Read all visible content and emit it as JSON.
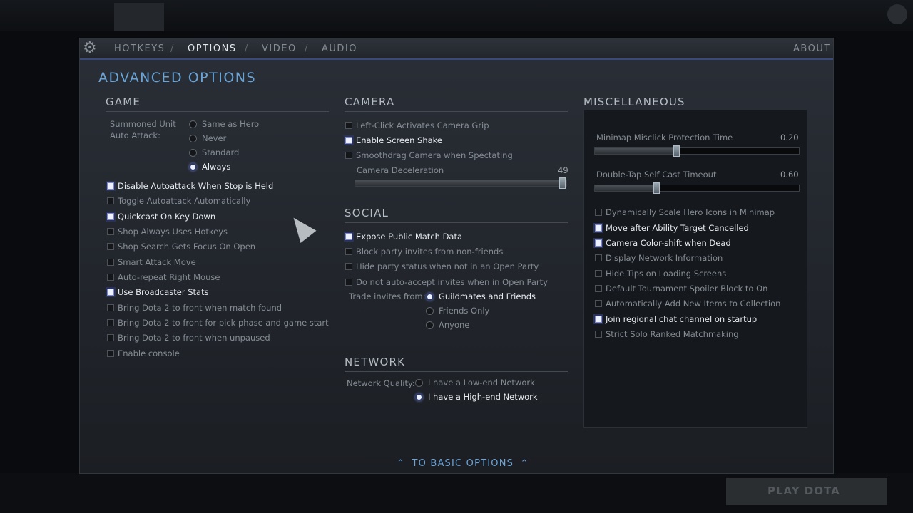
{
  "tabs": {
    "hotkeys": "HOTKEYS",
    "options": "OPTIONS",
    "video": "VIDEO",
    "audio": "AUDIO",
    "about": "ABOUT",
    "sep": "/"
  },
  "page_title": "ADVANCED OPTIONS",
  "icons": {
    "gear": "gear-icon",
    "cursor": "mouse-cursor-icon",
    "chevron": "chevron-up-icon"
  },
  "game": {
    "title": "GAME",
    "summoned_label_1": "Summoned Unit",
    "summoned_label_2": "Auto Attack:",
    "summoned_options": [
      "Same as Hero",
      "Never",
      "Standard",
      "Always"
    ],
    "summoned_selected": "Always",
    "checks": [
      {
        "label": "Disable Autoattack When Stop is Held",
        "checked": true
      },
      {
        "label": "Toggle Autoattack Automatically",
        "checked": false
      },
      {
        "label": "Quickcast On Key Down",
        "checked": true
      },
      {
        "label": "Shop Always Uses Hotkeys",
        "checked": false
      },
      {
        "label": "Shop Search Gets Focus On Open",
        "checked": false
      },
      {
        "label": "Smart Attack Move",
        "checked": false
      },
      {
        "label": "Auto-repeat Right Mouse",
        "checked": false
      },
      {
        "label": "Use Broadcaster Stats",
        "checked": true
      },
      {
        "label": "Bring Dota 2 to front when match found",
        "checked": false
      },
      {
        "label": "Bring Dota 2 to front for pick phase and game start",
        "checked": false
      },
      {
        "label": "Bring Dota 2 to front when unpaused",
        "checked": false
      },
      {
        "label": "Enable console",
        "checked": false
      }
    ]
  },
  "camera": {
    "title": "CAMERA",
    "checks": [
      {
        "label": "Left-Click Activates Camera Grip",
        "checked": false
      },
      {
        "label": "Enable Screen Shake",
        "checked": true
      },
      {
        "label": "Smoothdrag Camera when Spectating",
        "checked": false
      }
    ],
    "deceleration_label": "Camera Deceleration",
    "deceleration_value": "49",
    "deceleration_fraction": 0.98
  },
  "social": {
    "title": "SOCIAL",
    "checks": [
      {
        "label": "Expose Public Match Data",
        "checked": true
      },
      {
        "label": "Block party invites from non-friends",
        "checked": false
      },
      {
        "label": "Hide party status when not in an Open Party",
        "checked": false
      },
      {
        "label": "Do not auto-accept invites when in Open Party",
        "checked": false
      }
    ],
    "trade_label": "Trade invites from:",
    "trade_options": [
      "Guildmates and Friends",
      "Friends Only",
      "Anyone"
    ],
    "trade_selected": "Guildmates and Friends"
  },
  "network": {
    "title": "NETWORK",
    "label": "Network Quality:",
    "options": [
      "I have a Low-end Network",
      "I have a High-end Network"
    ],
    "selected": "I have a High-end Network"
  },
  "misc": {
    "title": "MISCELLANEOUS",
    "minimap_label": "Minimap Misclick Protection Time",
    "minimap_value": "0.20",
    "minimap_fraction": 0.4,
    "doubletap_label": "Double-Tap Self Cast Timeout",
    "doubletap_value": "0.60",
    "doubletap_fraction": 0.3,
    "checks": [
      {
        "label": "Dynamically Scale Hero Icons in Minimap",
        "checked": false
      },
      {
        "label": "Move after Ability Target Cancelled",
        "checked": true
      },
      {
        "label": "Camera Color-shift when Dead",
        "checked": true
      },
      {
        "label": "Display Network Information",
        "checked": false
      },
      {
        "label": "Hide Tips on Loading Screens",
        "checked": false
      },
      {
        "label": "Default Tournament Spoiler Block to On",
        "checked": false
      },
      {
        "label": "Automatically Add New Items to Collection",
        "checked": false
      },
      {
        "label": "Join regional chat channel on startup",
        "checked": true
      },
      {
        "label": "Strict Solo Ranked Matchmaking",
        "checked": false
      }
    ]
  },
  "basic_options": "TO BASIC OPTIONS",
  "play_dota": "PLAY DOTA"
}
